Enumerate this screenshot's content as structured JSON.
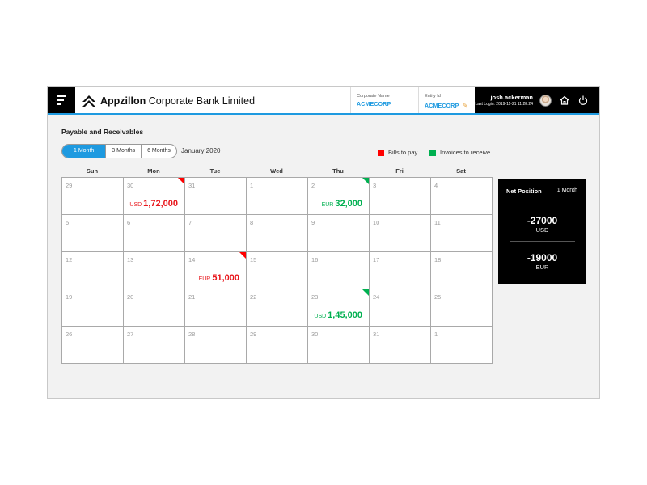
{
  "header": {
    "brand_bold": "Appzillon",
    "brand_rest": "Corporate Bank Limited",
    "corporate_label": "Corporate Name",
    "corporate_value": "ACMECORP",
    "entity_label": "Entity Id",
    "entity_value": "ACMECORP",
    "user_name": "josh.ackerman",
    "last_login": "Last Login: 2019-11-21 11:28:24"
  },
  "page": {
    "title": "Payable and Receivables",
    "month": "January 2020",
    "tabs": [
      "1 Month",
      "3 Months",
      "6 Months"
    ],
    "active_tab": "1 Month"
  },
  "legend": [
    {
      "label": "Bills to pay",
      "color": "#ff0000"
    },
    {
      "label": "Invoices to receive",
      "color": "#00b050"
    }
  ],
  "calendar": {
    "weekdays": [
      "Sun",
      "Mon",
      "Tue",
      "Wed",
      "Thu",
      "Fri",
      "Sat"
    ],
    "days": [
      "29",
      "30",
      "31",
      "1",
      "2",
      "3",
      "4",
      "5",
      "6",
      "7",
      "8",
      "9",
      "10",
      "11",
      "12",
      "13",
      "14",
      "15",
      "16",
      "17",
      "18",
      "19",
      "20",
      "21",
      "22",
      "23",
      "24",
      "25",
      "26",
      "27",
      "28",
      "29",
      "30",
      "31",
      "1"
    ],
    "events": [
      {
        "cell": 1,
        "type": "red",
        "currency": "USD",
        "amount": "1,72,000"
      },
      {
        "cell": 4,
        "type": "green",
        "currency": "EUR",
        "amount": "32,000"
      },
      {
        "cell": 16,
        "type": "red",
        "currency": "EUR",
        "amount": "51,000"
      },
      {
        "cell": 25,
        "type": "green",
        "currency": "USD",
        "amount": "1,45,000"
      }
    ],
    "colors": {
      "red": "#e8161b",
      "green": "#00b050"
    }
  },
  "net_position": {
    "title": "Net Position",
    "period": "1 Month",
    "items": [
      {
        "value": "-27000",
        "currency": "USD"
      },
      {
        "value": "-19000",
        "currency": "EUR"
      }
    ]
  },
  "icons": [
    "menu-icon",
    "appzillon-logo-icon",
    "pencil-icon",
    "avatar",
    "home-icon",
    "power-icon"
  ]
}
